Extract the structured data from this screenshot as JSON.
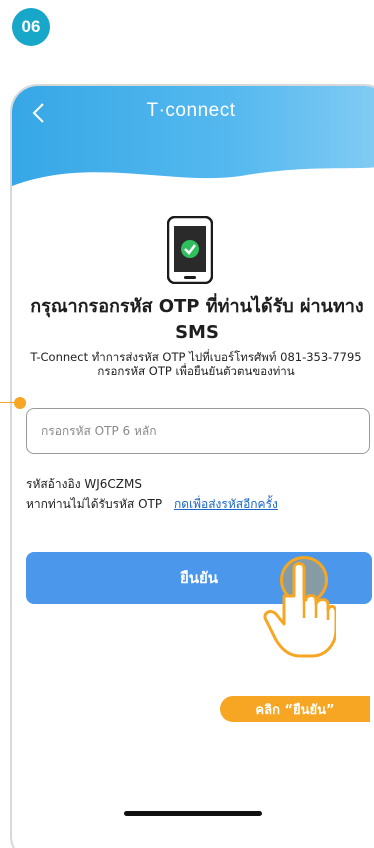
{
  "step_number": "06",
  "header": {
    "brand": "T·connect"
  },
  "main": {
    "title": "กรุณากรอกรหัส OTP ที่ท่านได้รับ ผ่านทาง SMS",
    "description_line1": "T-Connect ทำการส่งรหัส OTP ไปที่เบอร์โทรศัพท์ 081-353-7795",
    "description_line2": "กรอกรหัส OTP เพื่อยืนยันตัวตนของท่าน",
    "otp_placeholder": "กรอกรหัส OTP 6 หลัก",
    "reference_text": "รหัสอ้างอิง WJ6CZMS",
    "resend_prompt": "หากท่านไม่ได้รับรหัส OTP",
    "resend_link": "กดเพื่อส่งรหัสอีกครั้ง",
    "confirm_label": "ยืนยัน"
  },
  "annotation": {
    "click_label": "คลิก “ยืนยัน”"
  },
  "colors": {
    "step_badge": "#16a7c9",
    "header": "#36a7e6",
    "button": "#4a97ec",
    "highlight": "#f6a623",
    "link": "#1a66c8"
  }
}
